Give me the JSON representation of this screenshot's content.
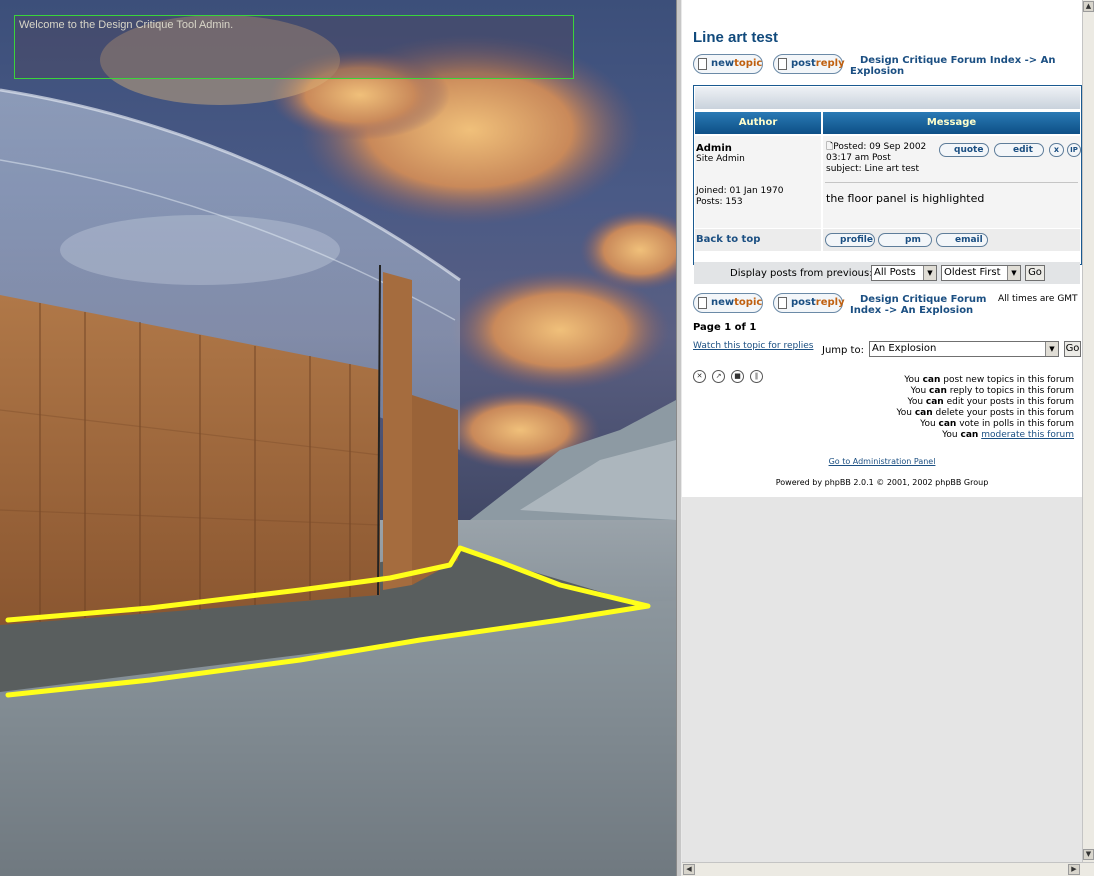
{
  "viewport": {
    "welcome": "Welcome to the Design Critique Tool Admin.",
    "highlight_color": "#ffff1a"
  },
  "forum": {
    "topic_title": "Line art test",
    "buttons": {
      "new_1": "new",
      "new_2": "topic",
      "reply_1": "post",
      "reply_2": "reply"
    },
    "breadcrumb_top": {
      "index": "Design Critique Forum Index",
      "sep": " -> ",
      "topic": "An Explosion"
    },
    "table": {
      "col_author": "Author",
      "col_message": "Message",
      "author_name": "Admin",
      "author_rank": "Site Admin",
      "joined": "Joined: 01 Jan 1970",
      "posts": "Posts: 153",
      "posted_line1": "Posted: 09 Sep 2002",
      "posted_line2": "03:17 am    Post",
      "subject": "subject: Line art test",
      "body": "the floor panel is highlighted",
      "back_to_top": "Back to top",
      "btn_quote": "quote",
      "btn_edit": "edit",
      "btn_delete": "x",
      "btn_ip": "IP",
      "btn_profile": "profile",
      "btn_pm": "pm",
      "btn_email": "email",
      "display_label": "Display posts from previous:",
      "filter_posts": "All Posts",
      "filter_order": "Oldest First",
      "go": "Go"
    },
    "breadcrumb_bottom": {
      "index": "Design Critique Forum",
      "index_2": "Index",
      "sep": " -> ",
      "topic": "An Explosion"
    },
    "timezone": "All times are GMT",
    "page_of": "Page 1 of 1",
    "watch_link": "Watch this topic for replies",
    "jump_label": "Jump to:",
    "jump_value": "An Explosion",
    "go": "Go",
    "permissions": {
      "l1a": "You ",
      "l1b": "can",
      "l1c": " post new topics in this forum",
      "l2a": "You ",
      "l2b": "can",
      "l2c": " reply to topics in this forum",
      "l3a": "You ",
      "l3b": "can",
      "l3c": " edit your posts in this forum",
      "l4a": "You ",
      "l4b": "can",
      "l4c": " delete your posts in this forum",
      "l5a": "You ",
      "l5b": "can",
      "l5c": " vote in polls in this forum",
      "l6a": "You ",
      "l6b": "can",
      "l6c": "moderate this forum"
    },
    "admin_link": "Go to Administration Panel",
    "powered_by": "Powered by phpBB 2.0.1 © 2001, 2002 phpBB Group"
  }
}
